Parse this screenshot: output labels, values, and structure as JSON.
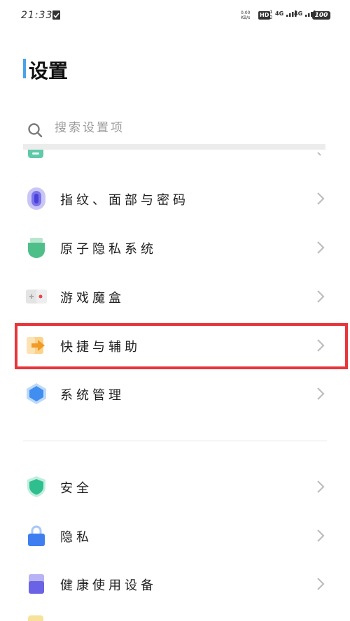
{
  "status_bar": {
    "time": "21:33",
    "speed_value": "0.00",
    "speed_unit": "KB/s",
    "hd": "HD",
    "sim_top": "1",
    "sim_bottom": "2",
    "signal1": "4G",
    "signal2": "4G",
    "battery": "100"
  },
  "page": {
    "title": "设置",
    "accent_color": "#4aa3e8"
  },
  "search": {
    "placeholder": "搜索设置项"
  },
  "items": [
    {
      "label": "指纹、面部与密码",
      "icon": "fingerprint-icon"
    },
    {
      "label": "原子隐私系统",
      "icon": "privacy-shield-icon"
    },
    {
      "label": "游戏魔盒",
      "icon": "gamepad-icon"
    },
    {
      "label": "快捷与辅助",
      "icon": "shortcut-arrow-icon"
    },
    {
      "label": "系统管理",
      "icon": "hexagon-icon"
    },
    {
      "label": "安全",
      "icon": "security-shield-icon"
    },
    {
      "label": "隐私",
      "icon": "lock-icon"
    },
    {
      "label": "健康使用设备",
      "icon": "health-icon"
    }
  ],
  "highlight_color": "#e8353b"
}
